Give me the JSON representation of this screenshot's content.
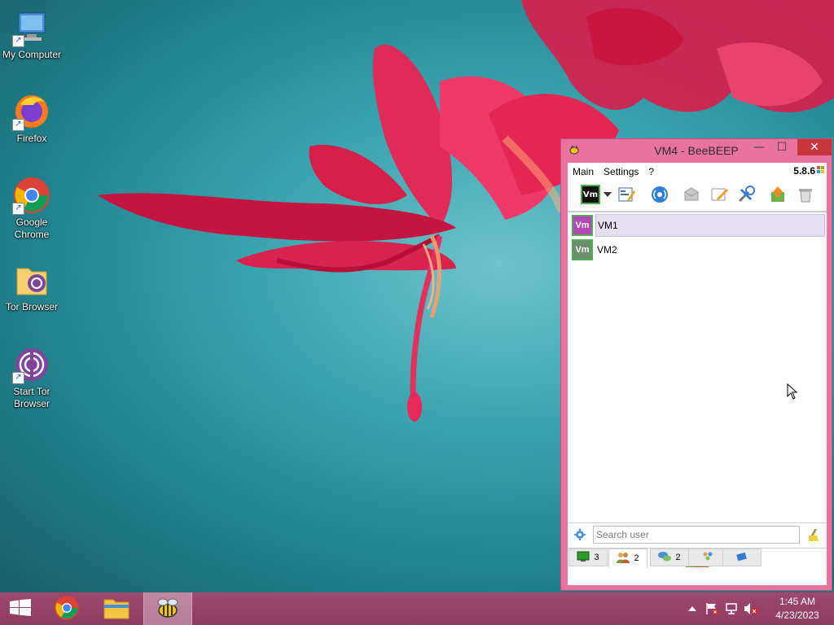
{
  "desktop": {
    "icons": [
      {
        "label": "My Computer",
        "icon": "my-computer-icon"
      },
      {
        "label": "Firefox",
        "icon": "firefox-icon"
      },
      {
        "label": "Google Chrome",
        "icon": "chrome-icon"
      },
      {
        "label": "Tor Browser",
        "icon": "tor-folder-icon"
      },
      {
        "label": "Start Tor Browser",
        "icon": "tor-browser-icon"
      }
    ]
  },
  "window": {
    "title": "VM4 - BeeBEEP",
    "controls": {
      "minimize": "—",
      "maximize": "☐",
      "close": "✕"
    },
    "menu": [
      "Main",
      "Settings",
      "?"
    ],
    "version": "5.8.6",
    "toolbar": {
      "status_badge": "Vm",
      "icons": [
        "status-dropdown-icon",
        "edit-profile-icon",
        "network-icon",
        "message-icon",
        "note-icon",
        "settings-tools-icon",
        "update-icon",
        "trash-icon"
      ]
    },
    "users": [
      {
        "badge": "Vm",
        "name": "VM1",
        "badge_color": "#b347b8",
        "selected": true
      },
      {
        "badge": "Vm",
        "name": "VM2",
        "badge_color": "#6d8f6d",
        "selected": false
      }
    ],
    "search": {
      "placeholder": "Search user"
    },
    "tabs": [
      {
        "icon": "computer-tab-icon",
        "count": "3",
        "active": false
      },
      {
        "icon": "users-tab-icon",
        "count": "2",
        "active": true
      },
      {
        "icon": "chats-tab-icon",
        "count": "2",
        "active": false
      },
      {
        "icon": "groups-tab-icon",
        "count": "",
        "active": false
      },
      {
        "icon": "files-tab-icon",
        "count": "",
        "active": false
      }
    ]
  },
  "taskbar": {
    "apps": [
      "windows-start-icon",
      "chrome-icon",
      "file-explorer-icon",
      "beebeep-icon"
    ],
    "tray": [
      "show-hidden-icon",
      "action-center-flag-icon",
      "network-icon",
      "volume-muted-icon"
    ],
    "time": "1:45 AM",
    "date": "4/23/2023"
  }
}
